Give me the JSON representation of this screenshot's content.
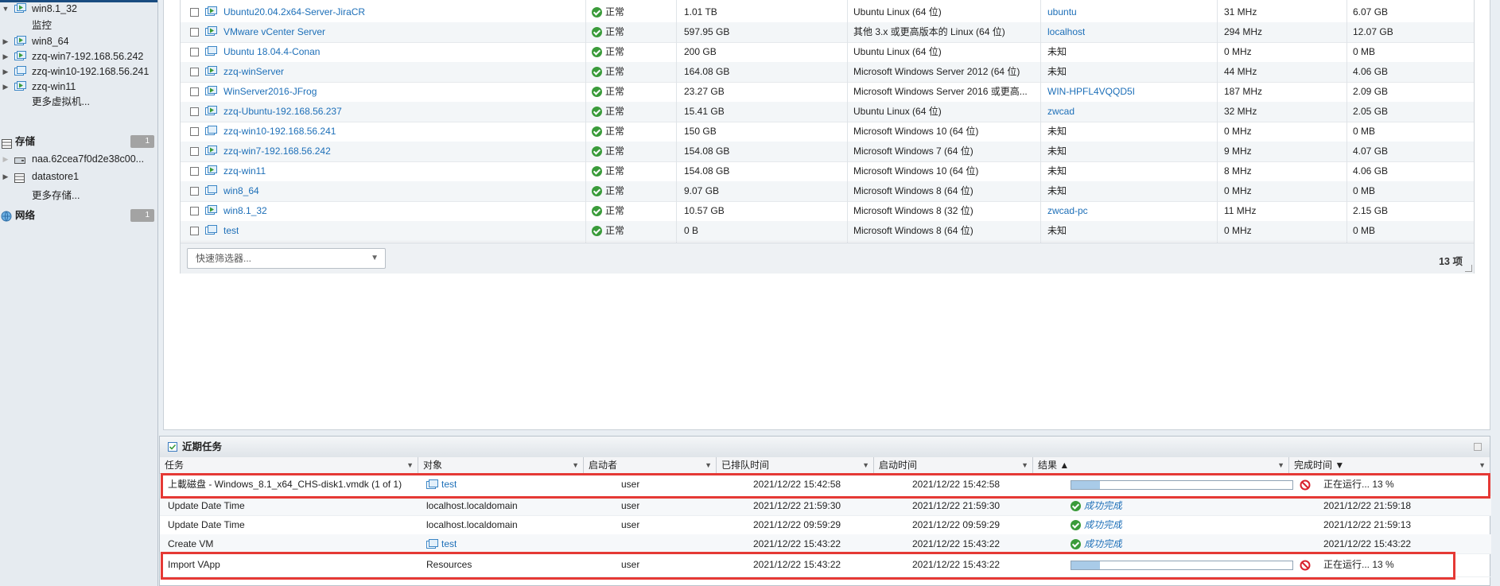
{
  "sidebar": {
    "items": [
      {
        "label": "win8.1_32",
        "icon": "vm-on-icon",
        "arrow": "expanded"
      },
      {
        "label": "监控",
        "icon": "",
        "arrow": ""
      },
      {
        "label": "win8_64",
        "icon": "vm-on-icon",
        "arrow": "collapsed"
      },
      {
        "label": "zzq-win7-192.168.56.242",
        "icon": "vm-on-icon",
        "arrow": "collapsed"
      },
      {
        "label": "zzq-win10-192.168.56.241",
        "icon": "vm-off-icon",
        "arrow": "collapsed"
      },
      {
        "label": "zzq-win11",
        "icon": "vm-on-icon",
        "arrow": "collapsed"
      },
      {
        "label": "更多虚拟机...",
        "icon": "",
        "arrow": ""
      }
    ],
    "storage": {
      "label": "存储",
      "count": "1",
      "items": [
        {
          "label": "naa.62cea7f0d2e38c00..."
        },
        {
          "label": "datastore1"
        },
        {
          "label": "更多存储..."
        }
      ]
    },
    "network": {
      "label": "网络",
      "count": "1"
    }
  },
  "vm_table": {
    "rows": [
      {
        "name": "Ubuntu20.04.2x64-Server-JiraCR",
        "status": "正常",
        "used": "1.01 TB",
        "os": "Ubuntu Linux (64 位)",
        "host": "ubuntu",
        "host_link": true,
        "cpu": "31 MHz",
        "mem": "6.07 GB",
        "power": "on"
      },
      {
        "name": "VMware vCenter Server",
        "status": "正常",
        "used": "597.95 GB",
        "os": "其他 3.x 或更高版本的 Linux (64 位)",
        "host": "localhost",
        "host_link": true,
        "cpu": "294 MHz",
        "mem": "12.07 GB",
        "power": "on"
      },
      {
        "name": "Ubuntu 18.04.4-Conan",
        "status": "正常",
        "used": "200 GB",
        "os": "Ubuntu Linux (64 位)",
        "host": "未知",
        "host_link": false,
        "cpu": "0 MHz",
        "mem": "0 MB",
        "power": "off"
      },
      {
        "name": "zzq-winServer",
        "status": "正常",
        "used": "164.08 GB",
        "os": "Microsoft Windows Server 2012 (64 位)",
        "host": "未知",
        "host_link": false,
        "cpu": "44 MHz",
        "mem": "4.06 GB",
        "power": "on"
      },
      {
        "name": "WinServer2016-JFrog",
        "status": "正常",
        "used": "23.27 GB",
        "os": "Microsoft Windows Server 2016 或更高...",
        "host": "WIN-HPFL4VQQD5I",
        "host_link": true,
        "cpu": "187 MHz",
        "mem": "2.09 GB",
        "power": "on"
      },
      {
        "name": "zzq-Ubuntu-192.168.56.237",
        "status": "正常",
        "used": "15.41 GB",
        "os": "Ubuntu Linux (64 位)",
        "host": "zwcad",
        "host_link": true,
        "cpu": "32 MHz",
        "mem": "2.05 GB",
        "power": "on"
      },
      {
        "name": "zzq-win10-192.168.56.241",
        "status": "正常",
        "used": "150 GB",
        "os": "Microsoft Windows 10 (64 位)",
        "host": "未知",
        "host_link": false,
        "cpu": "0 MHz",
        "mem": "0 MB",
        "power": "off"
      },
      {
        "name": "zzq-win7-192.168.56.242",
        "status": "正常",
        "used": "154.08 GB",
        "os": "Microsoft Windows 7 (64 位)",
        "host": "未知",
        "host_link": false,
        "cpu": "9 MHz",
        "mem": "4.07 GB",
        "power": "on"
      },
      {
        "name": "zzq-win11",
        "status": "正常",
        "used": "154.08 GB",
        "os": "Microsoft Windows 10 (64 位)",
        "host": "未知",
        "host_link": false,
        "cpu": "8 MHz",
        "mem": "4.06 GB",
        "power": "on"
      },
      {
        "name": "win8_64",
        "status": "正常",
        "used": "9.07 GB",
        "os": "Microsoft Windows 8 (64 位)",
        "host": "未知",
        "host_link": false,
        "cpu": "0 MHz",
        "mem": "0 MB",
        "power": "off"
      },
      {
        "name": "win8.1_32",
        "status": "正常",
        "used": "10.57 GB",
        "os": "Microsoft Windows 8 (32 位)",
        "host": "zwcad-pc",
        "host_link": true,
        "cpu": "11 MHz",
        "mem": "2.15 GB",
        "power": "on"
      },
      {
        "name": "test",
        "status": "正常",
        "used": "0 B",
        "os": "Microsoft Windows 8 (64 位)",
        "host": "未知",
        "host_link": false,
        "cpu": "0 MHz",
        "mem": "0 MB",
        "power": "off"
      }
    ],
    "quick_filter_placeholder": "快速筛选器...",
    "item_count": "13 项"
  },
  "tasks": {
    "title": "近期任务",
    "columns": [
      "任务",
      "对象",
      "启动者",
      "已排队时间",
      "启动时间",
      "结果 ▲",
      "完成时间 ▼"
    ],
    "rows": [
      {
        "task": "上載磁盘 - Windows_8.1_x64_CHS-disk1.vmdk (1 of 1)",
        "object": "test",
        "object_link": true,
        "initiator": "user",
        "queued": "2021/12/22 15:42:58",
        "started": "2021/12/22 15:42:58",
        "result_type": "progress",
        "progress": 13,
        "result_text": "",
        "completed": "正在运行... 13 %",
        "highlight": true
      },
      {
        "task": "Update Date Time",
        "object": "localhost.localdomain",
        "object_link": false,
        "initiator": "user",
        "queued": "2021/12/22 21:59:30",
        "started": "2021/12/22 21:59:30",
        "result_type": "success",
        "progress": 0,
        "result_text": "成功完成",
        "completed": "2021/12/22 21:59:18",
        "highlight": false
      },
      {
        "task": "Update Date Time",
        "object": "localhost.localdomain",
        "object_link": false,
        "initiator": "user",
        "queued": "2021/12/22 09:59:29",
        "started": "2021/12/22 09:59:29",
        "result_type": "success",
        "progress": 0,
        "result_text": "成功完成",
        "completed": "2021/12/22 21:59:13",
        "highlight": false
      },
      {
        "task": "Create VM",
        "object": "test",
        "object_link": true,
        "initiator": "",
        "queued": "2021/12/22 15:43:22",
        "started": "2021/12/22 15:43:22",
        "result_type": "success",
        "progress": 0,
        "result_text": "成功完成",
        "completed": "2021/12/22 15:43:22",
        "highlight": false
      },
      {
        "task": "Import VApp",
        "object": "Resources",
        "object_link": false,
        "initiator": "user",
        "queued": "2021/12/22 15:43:22",
        "started": "2021/12/22 15:43:22",
        "result_type": "progress",
        "progress": 13,
        "result_text": "",
        "completed": "正在运行... 13 %",
        "highlight": true
      }
    ]
  },
  "colors": {
    "link": "#1d6fb8",
    "ok": "#3a9b3a",
    "highlight_box": "#e53935",
    "vm_on": "#3a9b3a",
    "vm_icon_blue": "#3b86c6",
    "cancel": "#d9232e"
  }
}
